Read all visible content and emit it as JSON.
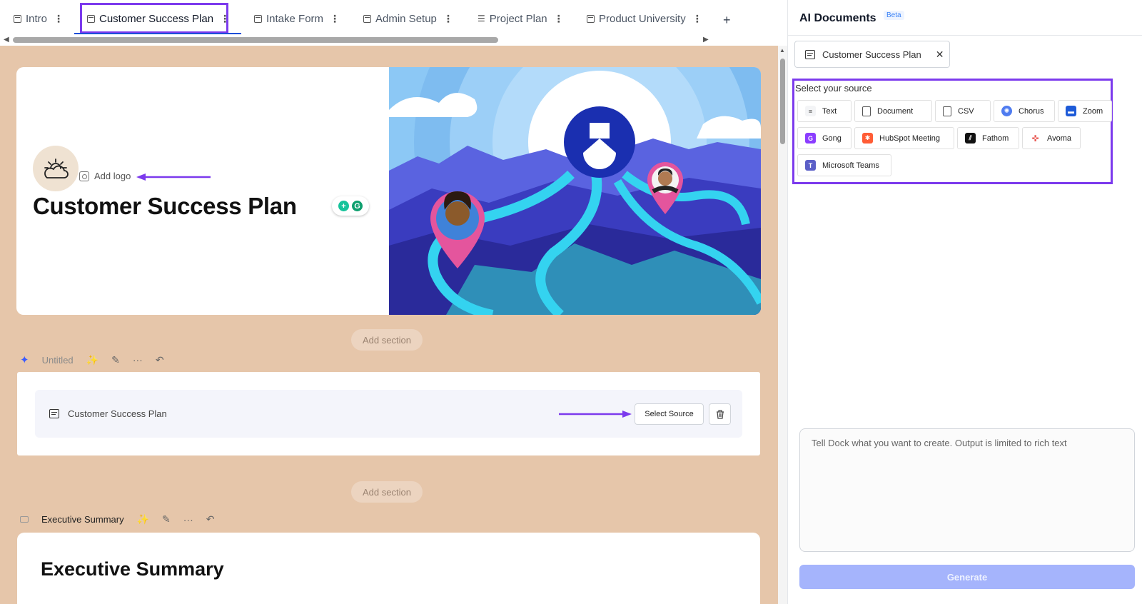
{
  "tabs": [
    {
      "label": "Intro"
    },
    {
      "label": "Customer Success Plan"
    },
    {
      "label": "Intake Form"
    },
    {
      "label": "Admin Setup"
    },
    {
      "label": "Project Plan"
    },
    {
      "label": "Product University"
    }
  ],
  "cover": {
    "add_logo": "Add logo",
    "title": "Customer Success Plan"
  },
  "add_section_label": "Add section",
  "ai_section": {
    "name": "Untitled",
    "doc_title": "Customer Success Plan",
    "select_source": "Select Source"
  },
  "exec_section": {
    "name": "Executive Summary",
    "heading": "Executive Summary"
  },
  "panel": {
    "title": "AI Documents",
    "badge": "Beta",
    "doc_chip": "Customer Success Plan",
    "source_label": "Select your source",
    "sources": [
      "Text",
      "Document",
      "CSV",
      "Chorus",
      "Zoom",
      "Gong",
      "HubSpot Meeting",
      "Fathom",
      "Avoma",
      "Microsoft Teams"
    ],
    "prompt_placeholder": "Tell Dock what you want to create. Output is limited to rich text",
    "generate": "Generate"
  },
  "colors": {
    "highlight": "#7c3aed",
    "canvas_bg": "#e6c6aa",
    "generate_btn": "#a5b4fc"
  }
}
